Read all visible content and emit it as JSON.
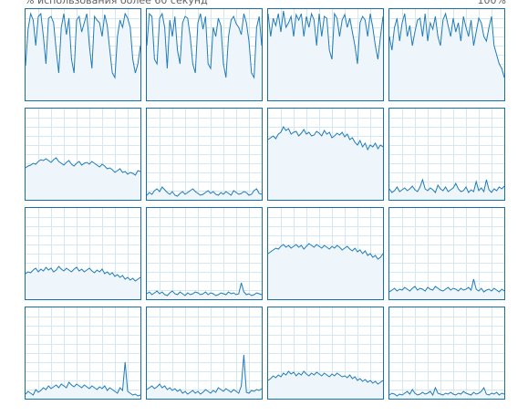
{
  "header": {
    "left_label": "% использования более 60 секунд",
    "right_label": "100%"
  },
  "colors": {
    "line": "#1f7cb8",
    "fill": "#eef5fb",
    "grid": "#d6e7f4",
    "border": "#1a6ea8"
  },
  "cpu_graphs": [
    {
      "name": "cpu-0",
      "values": [
        38,
        78,
        95,
        88,
        60,
        92,
        95,
        70,
        40,
        90,
        92,
        85,
        55,
        30,
        80,
        95,
        72,
        90,
        45,
        30,
        88,
        92,
        75,
        85,
        95,
        60,
        35,
        92,
        88,
        85,
        70,
        94,
        82,
        55,
        30,
        25,
        70,
        88,
        80,
        95,
        90,
        80,
        45,
        30,
        40,
        60
      ]
    },
    {
      "name": "cpu-1",
      "values": [
        60,
        95,
        92,
        45,
        40,
        90,
        95,
        80,
        35,
        88,
        70,
        92,
        55,
        40,
        85,
        92,
        90,
        70,
        40,
        30,
        85,
        95,
        78,
        92,
        40,
        35,
        80,
        70,
        90,
        82,
        40,
        25,
        70,
        88,
        92,
        84,
        80,
        72,
        95,
        85,
        65,
        30,
        25,
        80,
        92,
        60
      ]
    },
    {
      "name": "cpu-2",
      "values": [
        95,
        70,
        90,
        82,
        95,
        75,
        98,
        80,
        85,
        92,
        70,
        94,
        88,
        95,
        70,
        92,
        80,
        95,
        88,
        60,
        95,
        70,
        92,
        90,
        55,
        45,
        95,
        90,
        70,
        88,
        94,
        80,
        90,
        75,
        60,
        40,
        85,
        92,
        88,
        70,
        95,
        80,
        60,
        45,
        70,
        92
      ]
    },
    {
      "name": "cpu-3",
      "values": [
        70,
        55,
        80,
        90,
        65,
        85,
        95,
        70,
        82,
        60,
        75,
        88,
        90,
        70,
        95,
        65,
        85,
        78,
        92,
        70,
        60,
        88,
        95,
        82,
        70,
        90,
        75,
        85,
        65,
        92,
        80,
        70,
        88,
        60,
        75,
        90,
        85,
        70,
        65,
        80,
        92,
        60,
        50,
        40,
        35,
        25
      ]
    },
    {
      "name": "cpu-4",
      "values": [
        35,
        37,
        38,
        40,
        39,
        42,
        44,
        43,
        45,
        43,
        41,
        44,
        46,
        42,
        40,
        38,
        41,
        43,
        39,
        37,
        40,
        42,
        38,
        40,
        41,
        39,
        42,
        40,
        38,
        36,
        39,
        37,
        34,
        35,
        33,
        30,
        32,
        34,
        30,
        31,
        28,
        30,
        29,
        27,
        32,
        31
      ]
    },
    {
      "name": "cpu-5",
      "values": [
        5,
        8,
        6,
        10,
        12,
        9,
        14,
        11,
        8,
        6,
        9,
        5,
        4,
        7,
        9,
        6,
        8,
        10,
        12,
        9,
        7,
        5,
        6,
        8,
        10,
        7,
        9,
        6,
        5,
        8,
        6,
        9,
        7,
        5,
        10,
        8,
        6,
        7,
        9,
        8,
        5,
        6,
        10,
        12,
        7,
        6
      ]
    },
    {
      "name": "cpu-6",
      "values": [
        66,
        68,
        70,
        67,
        72,
        74,
        80,
        76,
        78,
        72,
        74,
        75,
        70,
        73,
        77,
        72,
        74,
        70,
        71,
        75,
        73,
        70,
        76,
        72,
        74,
        68,
        70,
        73,
        71,
        74,
        69,
        72,
        66,
        68,
        63,
        60,
        65,
        58,
        62,
        55,
        60,
        58,
        62,
        56,
        60,
        58
      ]
    },
    {
      "name": "cpu-7",
      "values": [
        12,
        8,
        10,
        14,
        9,
        11,
        13,
        10,
        12,
        15,
        11,
        9,
        14,
        22,
        12,
        10,
        13,
        11,
        8,
        16,
        12,
        10,
        14,
        9,
        11,
        13,
        18,
        12,
        9,
        10,
        14,
        8,
        11,
        9,
        20,
        10,
        13,
        9,
        22,
        11,
        8,
        12,
        10,
        14,
        12,
        15
      ]
    },
    {
      "name": "cpu-8",
      "values": [
        28,
        30,
        29,
        32,
        34,
        30,
        33,
        31,
        35,
        32,
        34,
        30,
        32,
        36,
        33,
        31,
        34,
        32,
        30,
        33,
        35,
        31,
        33,
        30,
        32,
        34,
        31,
        29,
        32,
        30,
        33,
        28,
        30,
        27,
        29,
        25,
        27,
        24,
        26,
        22,
        24,
        21,
        23,
        20,
        22,
        24
      ]
    },
    {
      "name": "cpu-9",
      "values": [
        6,
        8,
        5,
        7,
        9,
        6,
        8,
        5,
        4,
        7,
        9,
        6,
        5,
        8,
        6,
        4,
        7,
        5,
        6,
        8,
        7,
        5,
        6,
        8,
        5,
        7,
        6,
        4,
        5,
        7,
        6,
        5,
        8,
        6,
        7,
        5,
        6,
        18,
        8,
        5,
        6,
        4,
        5,
        7,
        6,
        5
      ]
    },
    {
      "name": "cpu-10",
      "values": [
        50,
        52,
        54,
        56,
        55,
        58,
        60,
        57,
        59,
        56,
        58,
        60,
        57,
        59,
        55,
        58,
        61,
        59,
        57,
        60,
        58,
        56,
        59,
        57,
        55,
        58,
        56,
        59,
        57,
        54,
        56,
        58,
        55,
        53,
        56,
        52,
        54,
        50,
        53,
        48,
        50,
        46,
        48,
        44,
        46,
        50
      ]
    },
    {
      "name": "cpu-11",
      "values": [
        8,
        10,
        12,
        9,
        11,
        10,
        13,
        11,
        9,
        12,
        14,
        10,
        12,
        11,
        9,
        13,
        11,
        10,
        14,
        12,
        10,
        9,
        11,
        13,
        10,
        12,
        11,
        9,
        12,
        10,
        11,
        13,
        10,
        22,
        11,
        9,
        12,
        8,
        10,
        11,
        9,
        12,
        10,
        8,
        11,
        9
      ]
    },
    {
      "name": "cpu-12",
      "values": [
        5,
        8,
        6,
        4,
        10,
        7,
        9,
        12,
        10,
        14,
        11,
        13,
        15,
        12,
        16,
        14,
        12,
        18,
        15,
        13,
        16,
        14,
        12,
        15,
        13,
        11,
        14,
        12,
        10,
        13,
        11,
        14,
        9,
        12,
        10,
        8,
        6,
        12,
        9,
        40,
        8,
        6,
        4,
        5,
        3,
        4
      ]
    },
    {
      "name": "cpu-13",
      "values": [
        10,
        12,
        14,
        11,
        13,
        16,
        12,
        14,
        10,
        12,
        9,
        11,
        8,
        10,
        6,
        8,
        5,
        7,
        9,
        6,
        8,
        5,
        7,
        10,
        8,
        6,
        9,
        7,
        12,
        10,
        8,
        11,
        9,
        7,
        10,
        8,
        6,
        14,
        48,
        7,
        6,
        9,
        8,
        10,
        9,
        11
      ]
    },
    {
      "name": "cpu-14",
      "values": [
        20,
        22,
        25,
        23,
        26,
        24,
        28,
        26,
        30,
        27,
        29,
        25,
        28,
        26,
        30,
        27,
        25,
        28,
        26,
        29,
        27,
        25,
        28,
        26,
        24,
        27,
        25,
        28,
        26,
        24,
        25,
        23,
        26,
        22,
        24,
        20,
        22,
        19,
        21,
        18,
        20,
        17,
        19,
        16,
        18,
        20
      ]
    },
    {
      "name": "cpu-15",
      "values": [
        4,
        6,
        5,
        3,
        5,
        4,
        6,
        8,
        5,
        10,
        6,
        4,
        5,
        7,
        5,
        6,
        8,
        4,
        12,
        6,
        5,
        4,
        6,
        5,
        7,
        5,
        4,
        6,
        5,
        8,
        6,
        5,
        4,
        7,
        5,
        6,
        8,
        12,
        5,
        4,
        6,
        5,
        7,
        4,
        6,
        5
      ]
    }
  ]
}
